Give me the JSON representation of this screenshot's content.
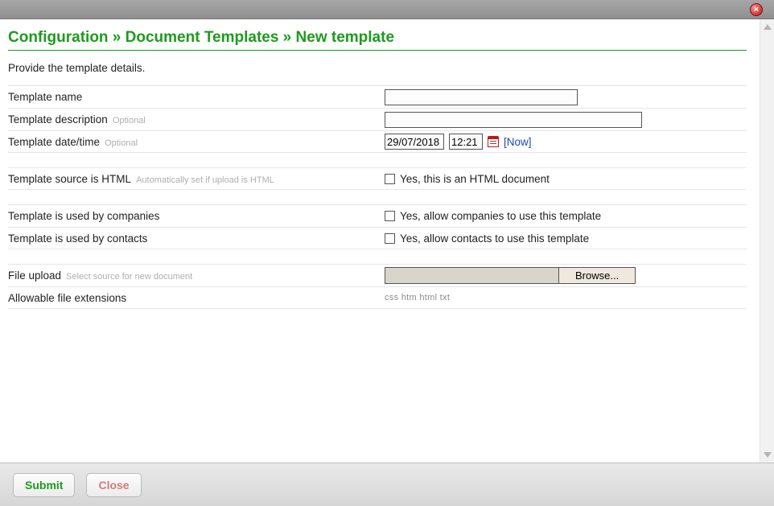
{
  "breadcrumb": {
    "a": "Configuration",
    "sep": " » ",
    "b": "Document Templates",
    "c": "New template"
  },
  "intro": "Provide the template details.",
  "labels": {
    "name": "Template name",
    "description": "Template description",
    "datetime": "Template date/time",
    "source_html": "Template source is HTML",
    "source_html_hint": "Automatically set if upload is HTML",
    "used_companies": "Template is used by companies",
    "used_contacts": "Template is used by contacts",
    "file_upload": "File upload",
    "file_upload_hint": "Select source for new document",
    "allowable_ext": "Allowable file extensions",
    "optional": "Optional"
  },
  "fields": {
    "name": "",
    "description": "",
    "date": "29/07/2018",
    "time": "12:21",
    "now_label": "[Now]",
    "html_checkbox_label": "Yes, this is an HTML document",
    "companies_checkbox_label": "Yes, allow companies to use this template",
    "contacts_checkbox_label": "Yes, allow contacts to use this template",
    "browse_label": "Browse...",
    "ext_list": "css  htm  html  txt"
  },
  "buttons": {
    "submit": "Submit",
    "close": "Close"
  }
}
